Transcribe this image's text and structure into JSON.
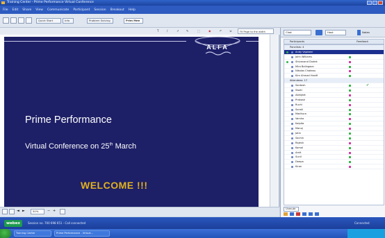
{
  "window": {
    "title": "Training Center - Prime Performance Virtual Conference"
  },
  "menu": {
    "items": [
      "File",
      "Edit",
      "Share",
      "View",
      "Communicate",
      "Participant",
      "Session",
      "Breakout",
      "Help"
    ]
  },
  "toolbar": {
    "tabs": [
      "Quick Start",
      "Info",
      "Problem Solving",
      "Prim Mee"
    ]
  },
  "annotation": {
    "tools": [
      "T",
      "/",
      "↗",
      "✎",
      "⬚",
      "◉",
      "↶",
      "⇲",
      "Fit Page to the width"
    ]
  },
  "slide": {
    "brand": "ALFA",
    "title": "Prime Performance",
    "subtitle_main": "Virtual Conference on 25",
    "subtitle_sup": "th",
    "subtitle_end": " March",
    "welcome": "WELCOME !!!",
    "colors": {
      "background": "#1d1f67",
      "welcome": "#e2b11e",
      "text": "#ffffff"
    }
  },
  "bottom_controls": {
    "zoom": "50%"
  },
  "right_panel": {
    "chat_label": "Chat",
    "send_to": "Host",
    "notes_label": "Notes",
    "list_header": {
      "col1": "Participants",
      "col2": "Feedback"
    },
    "groups": [
      {
        "label": "Panelists: 4",
        "members": [
          {
            "name": "Andy Vajzbeni",
            "selected": true,
            "presenter": true
          },
          {
            "name": "John Williams"
          },
          {
            "name": "Shivanand Dudek",
            "host": true
          },
          {
            "name": "Mira Balingaon"
          },
          {
            "name": "Nikolas Chateau"
          },
          {
            "name": "Kim Ahmad Hanifi"
          }
        ]
      },
      {
        "label": "Attendees: 17",
        "members": [
          {
            "name": "Santosh",
            "check": true
          },
          {
            "name": "Swati"
          },
          {
            "name": "Abhijeet"
          },
          {
            "name": "Prakash"
          },
          {
            "name": "Ruchi"
          },
          {
            "name": "Sonali"
          },
          {
            "name": "Madhura"
          },
          {
            "name": "Varsha"
          },
          {
            "name": "Kalpita"
          },
          {
            "name": "Manoj"
          },
          {
            "name": "Jatin"
          },
          {
            "name": "Sachin"
          },
          {
            "name": "Rajesh"
          },
          {
            "name": "Komal"
          },
          {
            "name": "Amit"
          },
          {
            "name": "Sunil"
          },
          {
            "name": "Deepa"
          },
          {
            "name": "Kiran"
          }
        ]
      }
    ],
    "bottom_btn": "Unmute"
  },
  "status": {
    "logo": "webex",
    "session": "Session no. 700 698 651 - Call connected",
    "right": "Connected"
  },
  "taskbar": {
    "items": [
      "Training Center",
      "Prime Performance - Virtual..."
    ]
  }
}
